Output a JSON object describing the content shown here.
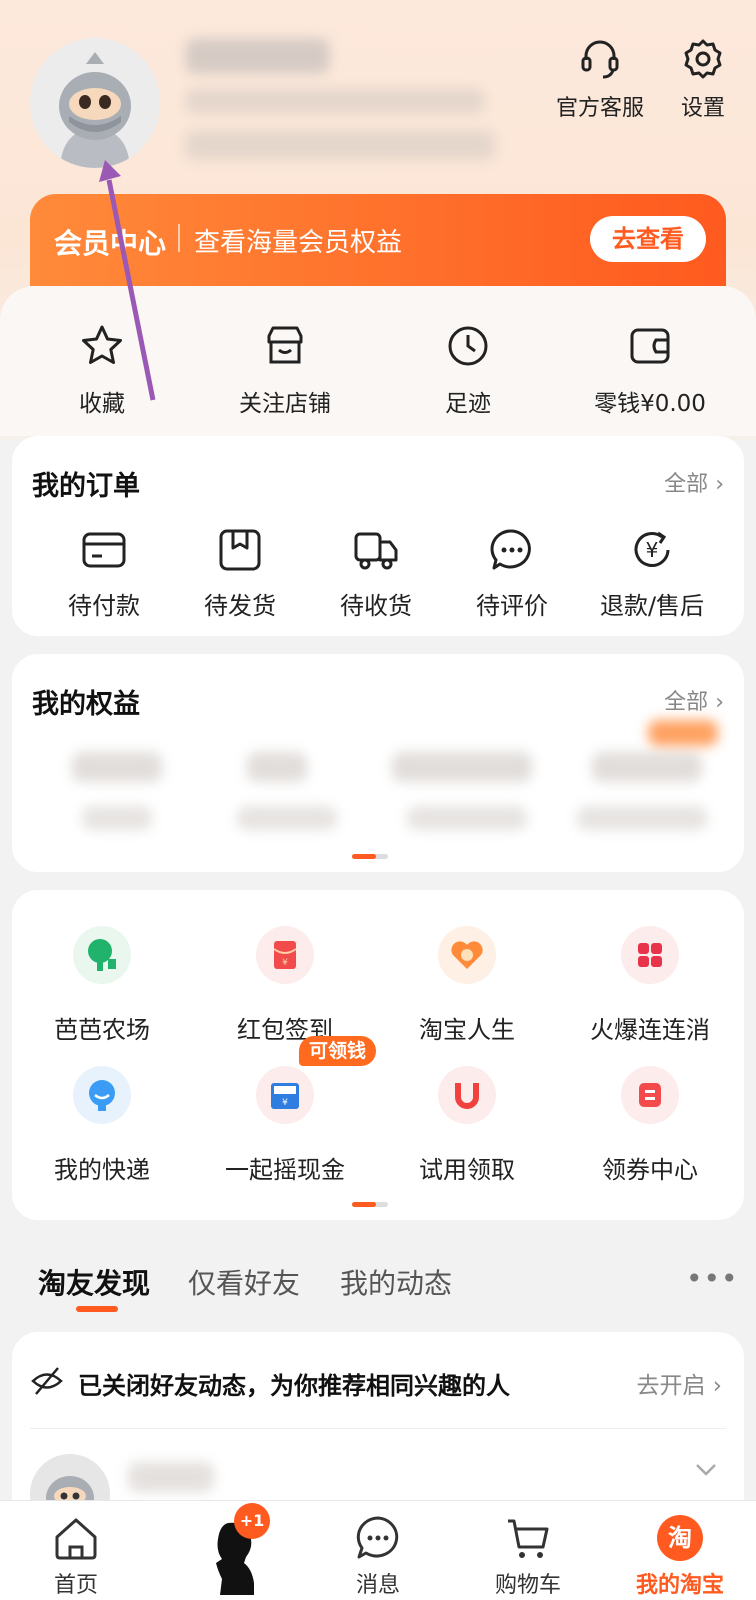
{
  "header": {
    "service_label": "官方客服",
    "settings_label": "设置"
  },
  "member_bar": {
    "title": "会员中心",
    "subtitle": "查看海量会员权益",
    "button": "去查看"
  },
  "quick_links": [
    {
      "label": "收藏",
      "icon": "star-icon"
    },
    {
      "label": "关注店铺",
      "icon": "store-icon"
    },
    {
      "label": "足迹",
      "icon": "clock-icon"
    },
    {
      "label": "零钱¥0.00",
      "icon": "wallet-icon"
    }
  ],
  "orders": {
    "title": "我的订单",
    "all_label": "全部",
    "items": [
      {
        "label": "待付款",
        "icon": "card-icon"
      },
      {
        "label": "待发货",
        "icon": "box-icon"
      },
      {
        "label": "待收货",
        "icon": "truck-icon"
      },
      {
        "label": "待评价",
        "icon": "chat-icon"
      },
      {
        "label": "退款/售后",
        "icon": "refund-icon"
      }
    ]
  },
  "benefits": {
    "title": "我的权益",
    "all_label": "全部"
  },
  "services": {
    "badge": "可领钱",
    "items": [
      {
        "label": "芭芭农场",
        "icon": "tree-icon",
        "color": "#e9f7ee"
      },
      {
        "label": "红包签到",
        "icon": "red-envelope-icon",
        "color": "#fdecec"
      },
      {
        "label": "淘宝人生",
        "icon": "heart-icon",
        "color": "#fef0e4"
      },
      {
        "label": "火爆连连消",
        "icon": "gem-cluster-icon",
        "color": "#fdecec"
      },
      {
        "label": "我的快递",
        "icon": "courier-icon",
        "color": "#e8f2fd"
      },
      {
        "label": "一起摇现金",
        "icon": "cash-icon",
        "color": "#fdecec"
      },
      {
        "label": "试用领取",
        "icon": "u-icon",
        "color": "#fdecec"
      },
      {
        "label": "领券中心",
        "icon": "coupon-icon",
        "color": "#fdecec"
      }
    ]
  },
  "feed_tabs": [
    {
      "label": "淘友发现"
    },
    {
      "label": "仅看好友"
    },
    {
      "label": "我的动态"
    }
  ],
  "feed": {
    "notice": "已关闭好友动态，为你推荐相同兴趣的人",
    "action": "去开启"
  },
  "bottom_nav": [
    {
      "label": "首页",
      "icon": "home-icon"
    },
    {
      "label": "",
      "icon": "profile-silhouette-icon",
      "badge": "+1"
    },
    {
      "label": "消息",
      "icon": "message-icon"
    },
    {
      "label": "购物车",
      "icon": "cart-icon"
    },
    {
      "label": "我的淘宝",
      "icon": "taobao-icon"
    }
  ],
  "colors": {
    "accent": "#ff5a1f",
    "annotation_arrow": "#9b59b6"
  }
}
